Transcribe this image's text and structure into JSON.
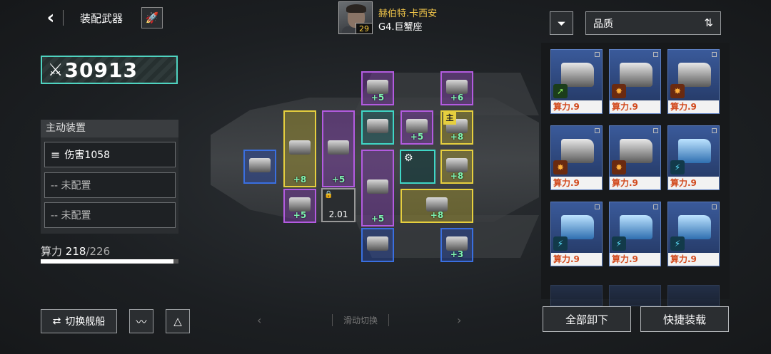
{
  "header": {
    "title": "装配武器",
    "back_icon": "chevron-left-icon",
    "edit_icon": "rocket-icon"
  },
  "pilot": {
    "name": "赫伯特.卡西安",
    "level": "29",
    "class": "G4.巨蟹座"
  },
  "power": {
    "value": "30913",
    "accent": "#4fd3c0"
  },
  "active_devices": {
    "header": "主动装置",
    "slots": [
      {
        "label": "伤害1058",
        "icon": "slash-icon"
      },
      {
        "label": "-- 未配置"
      },
      {
        "label": "-- 未配置"
      }
    ]
  },
  "calc_power": {
    "label": "算力",
    "current": "218",
    "separator": "/",
    "max": "226",
    "fraction": 0.965
  },
  "bottom_left": {
    "switch_label": "切换舰船",
    "switch_icon": "swap-icon",
    "wave_icon": "waveform-icon",
    "radar_icon": "triangle-target-icon"
  },
  "swipe_hint": "滑动切换",
  "ship_modules": [
    {
      "color": "purple",
      "bonus": "+5"
    },
    {
      "color": "purple",
      "bonus": "+6"
    },
    {
      "color": "yellow",
      "bonus": "+8"
    },
    {
      "color": "purple",
      "bonus": "+5"
    },
    {
      "color": "teal",
      "bonus": ""
    },
    {
      "color": "purple",
      "bonus": "+5"
    },
    {
      "color": "yellow",
      "bonus": "+8"
    },
    {
      "color": "blue",
      "bonus": ""
    },
    {
      "color": "purple",
      "bonus": "+5"
    },
    {
      "color": "yellow",
      "bonus": "+8"
    },
    {
      "color": "purple",
      "bonus": "+5"
    },
    {
      "color": "yellow",
      "bonus": "+8"
    },
    {
      "color": "blue",
      "bonus": ""
    },
    {
      "color": "blue",
      "bonus": "+3"
    }
  ],
  "main_tag": "主",
  "locked_module": {
    "cooldown": "2.01"
  },
  "right_panel": {
    "filter_icon": "filter-icon",
    "sort_label": "品质",
    "sort_icon": "sort-icon",
    "cards": [
      {
        "label": "算力.9",
        "element": "green"
      },
      {
        "label": "算力.9",
        "element": "orange"
      },
      {
        "label": "算力.9",
        "element": "orange"
      },
      {
        "label": "算力.9",
        "element": "orange"
      },
      {
        "label": "算力.9",
        "element": "orange"
      },
      {
        "label": "算力.9",
        "element": "cyan"
      },
      {
        "label": "算力.9",
        "element": "cyan"
      },
      {
        "label": "算力.9",
        "element": "cyan"
      },
      {
        "label": "算力.9",
        "element": "cyan"
      }
    ],
    "unequip_label": "全部卸下",
    "quick_label": "快捷装载"
  }
}
